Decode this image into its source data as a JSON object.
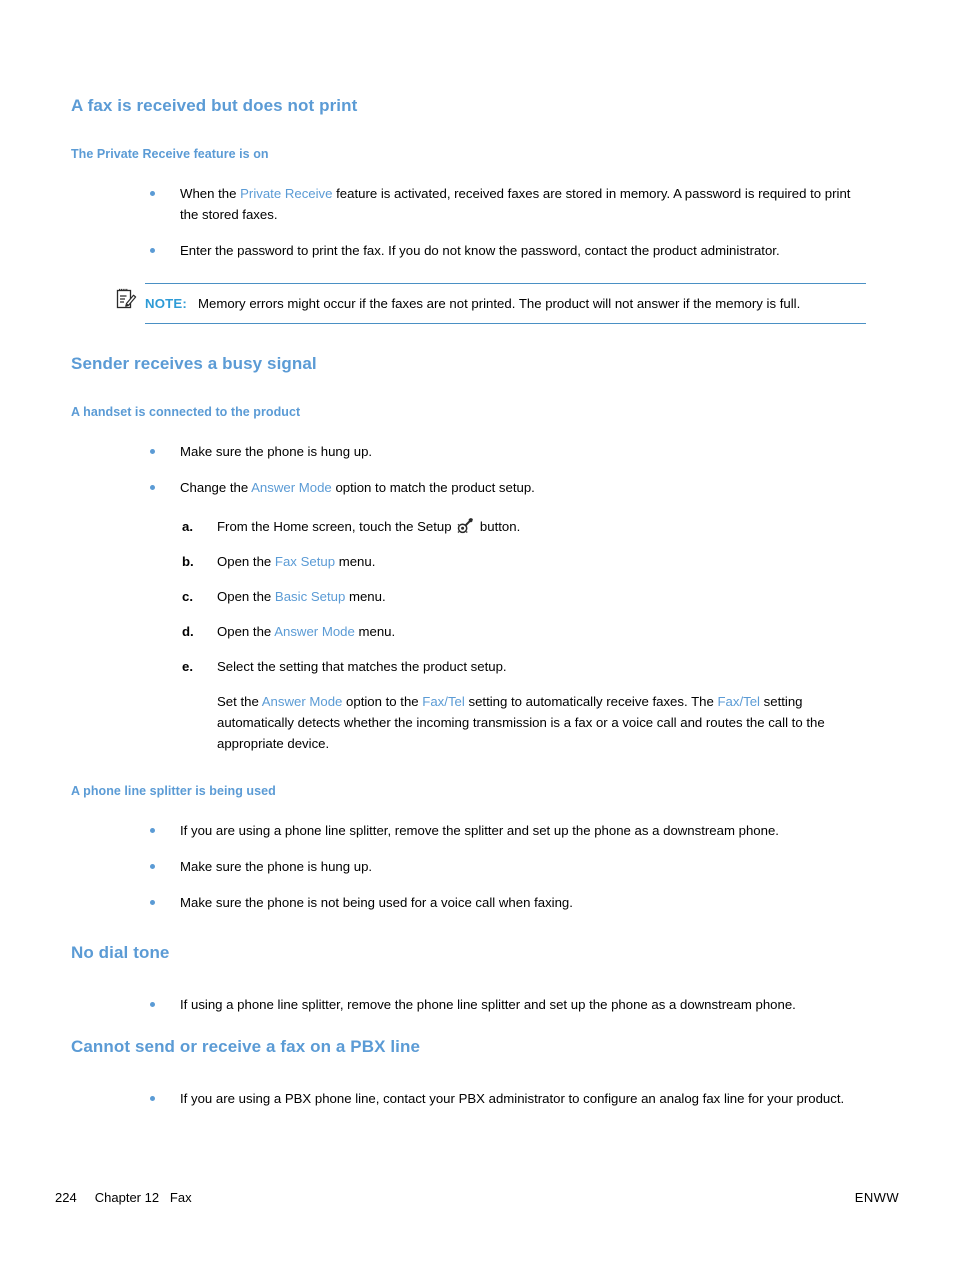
{
  "document": {
    "footer": {
      "page_number": "224",
      "chapter": "Chapter 12   Fax",
      "right_label": "ENWW"
    }
  },
  "sections": [
    {
      "id": "fax-received-not-print",
      "title": "A fax is received but does not print",
      "subsections": [
        {
          "id": "private-receive-on",
          "title": "The Private Receive feature is on",
          "bullets": [
            {
              "parts": [
                {
                  "t": "When the ",
                  "style": "plain"
                },
                {
                  "t": "Private Receive",
                  "style": "blue"
                },
                {
                  "t": " feature is activated, received faxes are stored in memory. A password is required to print the stored faxes.",
                  "style": "plain"
                }
              ]
            },
            {
              "parts": [
                {
                  "t": "Enter the password to print the fax. If you do not know the password, contact the product administrator.",
                  "style": "plain"
                }
              ]
            }
          ],
          "note": {
            "icon": "note-pad-pencil-icon",
            "label": "NOTE:",
            "text": "Memory errors might occur if the faxes are not printed. The product will not answer if the memory is full."
          }
        }
      ]
    },
    {
      "id": "sender-busy-signal",
      "title": "Sender receives a busy signal",
      "subsections": [
        {
          "id": "handset-connected",
          "title": "A handset is connected to the product",
          "bullets": [
            {
              "parts": [
                {
                  "t": "Make sure the phone is hung up.",
                  "style": "plain"
                }
              ]
            },
            {
              "parts": [
                {
                  "t": "Change the ",
                  "style": "plain"
                },
                {
                  "t": "Answer Mode",
                  "style": "blue"
                },
                {
                  "t": " option to match the product setup.",
                  "style": "plain"
                }
              ]
            }
          ],
          "steps": [
            {
              "marker": "a.",
              "parts": [
                {
                  "t": "From the Home screen, touch the Setup ",
                  "style": "plain"
                },
                {
                  "t": "",
                  "style": "setup-icon"
                },
                {
                  "t": " button.",
                  "style": "plain"
                }
              ]
            },
            {
              "marker": "b.",
              "parts": [
                {
                  "t": "Open the ",
                  "style": "plain"
                },
                {
                  "t": "Fax Setup",
                  "style": "blue"
                },
                {
                  "t": " menu.",
                  "style": "plain"
                }
              ]
            },
            {
              "marker": "c.",
              "parts": [
                {
                  "t": "Open the ",
                  "style": "plain"
                },
                {
                  "t": "Basic Setup",
                  "style": "blue"
                },
                {
                  "t": " menu.",
                  "style": "plain"
                }
              ]
            },
            {
              "marker": "d.",
              "parts": [
                {
                  "t": "Open the ",
                  "style": "plain"
                },
                {
                  "t": "Answer Mode",
                  "style": "blue"
                },
                {
                  "t": " menu.",
                  "style": "plain"
                }
              ]
            },
            {
              "marker": "e.",
              "parts": [
                {
                  "t": "Select the setting that matches the product setup.",
                  "style": "plain"
                }
              ],
              "extra_paragraph": [
                {
                  "t": "Set the ",
                  "style": "plain"
                },
                {
                  "t": "Answer Mode",
                  "style": "blue"
                },
                {
                  "t": " option to the ",
                  "style": "plain"
                },
                {
                  "t": "Fax/Tel",
                  "style": "blue"
                },
                {
                  "t": " setting to automatically receive faxes. The ",
                  "style": "plain"
                },
                {
                  "t": "Fax/Tel",
                  "style": "blue"
                },
                {
                  "t": " setting automatically detects whether the incoming transmission is a fax or a voice call and routes the call to the appropriate device.",
                  "style": "plain"
                }
              ]
            }
          ]
        },
        {
          "id": "phone-line-splitter",
          "title": "A phone line splitter is being used",
          "bullets": [
            {
              "parts": [
                {
                  "t": "If you are using a phone line splitter, remove the splitter and set up the phone as a downstream phone.",
                  "style": "plain"
                }
              ]
            },
            {
              "parts": [
                {
                  "t": "Make sure the phone is hung up.",
                  "style": "plain"
                }
              ]
            },
            {
              "parts": [
                {
                  "t": "Make sure the phone is not being used for a voice call when faxing.",
                  "style": "plain"
                }
              ]
            }
          ]
        }
      ]
    },
    {
      "id": "no-dial-tone",
      "title": "No dial tone",
      "bullets": [
        {
          "parts": [
            {
              "t": "If using a phone line splitter, remove the phone line splitter and set up the phone as a downstream phone.",
              "style": "plain"
            }
          ]
        }
      ]
    },
    {
      "id": "pbx-line",
      "title": "Cannot send or receive a fax on a PBX line",
      "bullets": [
        {
          "parts": [
            {
              "t": "If you are using a PBX phone line, contact your PBX administrator to configure an analog fax line for your product.",
              "style": "plain"
            }
          ]
        }
      ]
    }
  ],
  "colors": {
    "heading_blue": "#5b9bd5",
    "term_blue": "#5b9bd5",
    "note_rule": "#4a90c4",
    "note_label": "#2e9bd6",
    "body_text": "#000000"
  }
}
